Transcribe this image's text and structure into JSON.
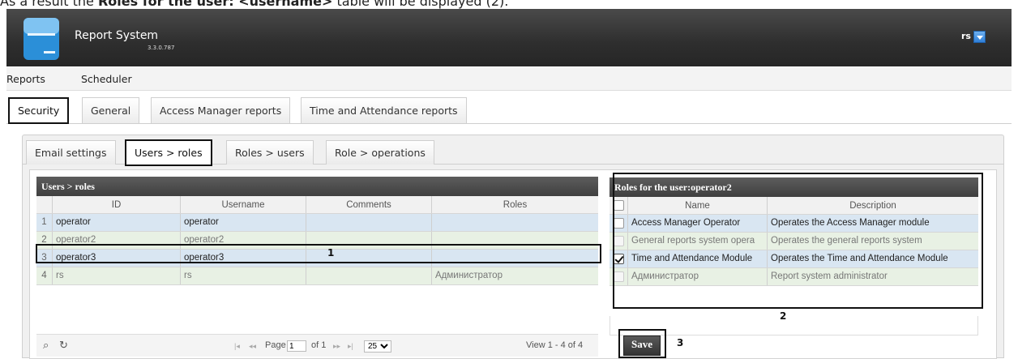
{
  "caption": {
    "prefix": "As a result the",
    "bold": "Roles for the user: <username>",
    "suffix": "table will be displayed (2)."
  },
  "app": {
    "title": "Report System",
    "version": "3.3.0.787",
    "user": "rs"
  },
  "menu": [
    "Reports",
    "Scheduler"
  ],
  "top_tabs": [
    "Security",
    "General",
    "Access Manager reports",
    "Time and Attendance reports"
  ],
  "inner_tabs": [
    "Email settings",
    "Users > roles",
    "Roles > users",
    "Role > operations"
  ],
  "users_grid": {
    "caption": "Users > roles",
    "columns": [
      "ID",
      "Username",
      "Comments",
      "Roles"
    ],
    "rows": [
      {
        "n": "1",
        "id": "operator",
        "username": "operator",
        "comments": "",
        "roles": ""
      },
      {
        "n": "2",
        "id": "operator2",
        "username": "operator2",
        "comments": "",
        "roles": ""
      },
      {
        "n": "3",
        "id": "operator3",
        "username": "operator3",
        "comments": "",
        "roles": ""
      },
      {
        "n": "4",
        "id": "rs",
        "username": "rs",
        "comments": "",
        "roles": "Администратор"
      }
    ],
    "pager": {
      "search_icon": "⌕",
      "refresh_icon": "↻",
      "first": "|◂",
      "prev": "◂◂",
      "page_label": "Page",
      "page_value": "1",
      "of_label": "of 1",
      "next": "▸▸",
      "last": "▸|",
      "page_size": "25",
      "view": "View 1 - 4 of 4"
    }
  },
  "roles_grid": {
    "caption": "Roles for the user:operator2",
    "columns": [
      "Name",
      "Description"
    ],
    "rows": [
      {
        "name": "Access Manager Operator",
        "description": "Operates the Access Manager module",
        "checked": false,
        "disabled": false
      },
      {
        "name": "General reports system opera",
        "description": "Operates the general reports system",
        "checked": false,
        "disabled": true
      },
      {
        "name": "Time and Attendance Module",
        "description": "Operates the Time and Attendance Module",
        "checked": true,
        "disabled": false
      },
      {
        "name": "Администратор",
        "description": "Report system administrator",
        "checked": false,
        "disabled": true
      }
    ]
  },
  "save_label": "Save",
  "callouts": [
    "1",
    "2",
    "3"
  ]
}
